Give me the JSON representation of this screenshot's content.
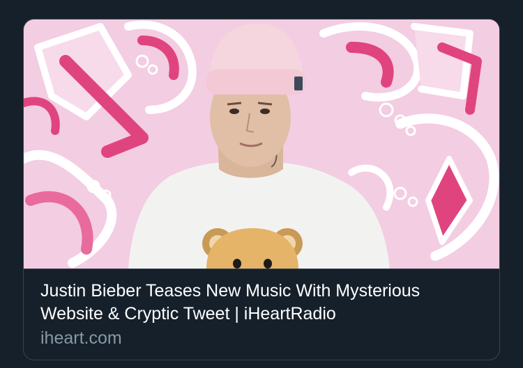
{
  "link_card": {
    "title": "Justin Bieber Teases New Music With Mysterious Website & Cryptic Tweet | iHeartRadio",
    "domain": "iheart.com",
    "image_subject": "person-in-pink-beanie-and-bear-tshirt-photo"
  },
  "colors": {
    "page_background": "#15202b",
    "card_border": "#38444d",
    "title_text": "#ffffff",
    "domain_text": "#8899a6",
    "mural_pink": "#f2c9df",
    "mural_magenta": "#e0447f"
  }
}
